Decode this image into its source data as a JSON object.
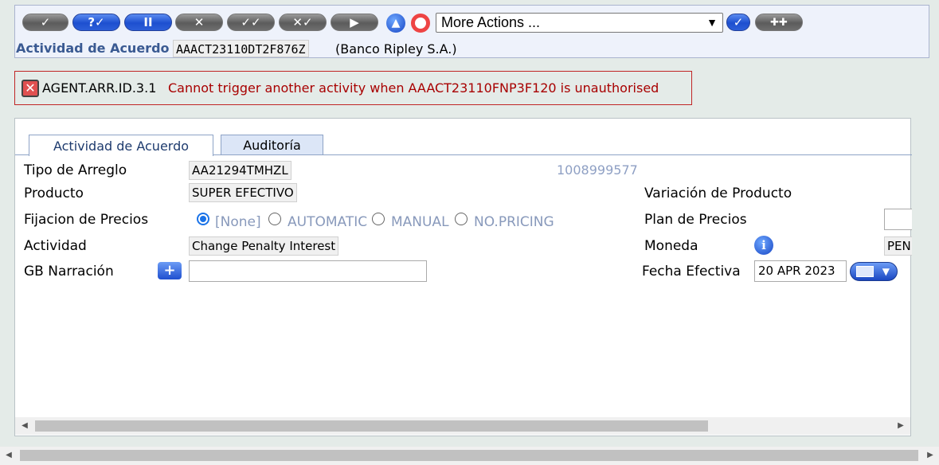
{
  "toolbar": {
    "buttons": [
      {
        "name": "commit-button",
        "icon": "check-icon",
        "glyph": "✓",
        "style": "grey"
      },
      {
        "name": "validate-button",
        "icon": "question-check-icon",
        "glyph": "?✓",
        "style": "blue"
      },
      {
        "name": "hold-button",
        "icon": "pause-icon",
        "glyph": "II",
        "style": "blue"
      },
      {
        "name": "delete-button",
        "icon": "x-icon",
        "glyph": "✕",
        "style": "grey"
      },
      {
        "name": "authorise-button",
        "icon": "double-check-icon",
        "glyph": "✓✓",
        "style": "grey"
      },
      {
        "name": "reverse-button",
        "icon": "x-check-icon",
        "glyph": "✕✓",
        "style": "grey"
      },
      {
        "name": "next-button",
        "icon": "play-icon",
        "glyph": "▶",
        "style": "grey"
      }
    ],
    "more_actions": "More Actions ...",
    "go_glyph": "✓",
    "plus_glyph": "✚✚"
  },
  "header": {
    "title": "Actividad de Acuerdo",
    "id": "AAACT23110DT2F876Z",
    "company": "(Banco Ripley S.A.)"
  },
  "error": {
    "code": "AGENT.ARR.ID.3.1",
    "message": "Cannot trigger another activity when AAACT23110FNP3F120 is unauthorised"
  },
  "tabs": [
    {
      "label": "Actividad de Acuerdo",
      "active": true
    },
    {
      "label": "Auditoría",
      "active": false
    }
  ],
  "form": {
    "tipo_arreglo": {
      "label": "Tipo de Arreglo",
      "value": "AA21294TMHZL"
    },
    "customer_number": "1008999577",
    "producto": {
      "label": "Producto",
      "value": "SUPER EFECTIVO"
    },
    "variacion": {
      "label": "Variación de Producto"
    },
    "fijacion": {
      "label": "Fijacion de Precios",
      "options": [
        "[None]",
        "AUTOMATIC",
        "MANUAL",
        "NO.PRICING"
      ],
      "selected": "[None]"
    },
    "plan_precios": {
      "label": "Plan de Precios"
    },
    "actividad": {
      "label": "Actividad",
      "value": "Change Penalty Interest"
    },
    "moneda": {
      "label": "Moneda",
      "value": "PEN"
    },
    "narracion": {
      "label": "GB Narración",
      "value": ""
    },
    "fecha": {
      "label": "Fecha Efectiva",
      "value": "20 APR 2023"
    }
  },
  "colors": {
    "error": "#a80000",
    "accent": "#1d4fcf",
    "label_blue": "#3a5a92"
  }
}
